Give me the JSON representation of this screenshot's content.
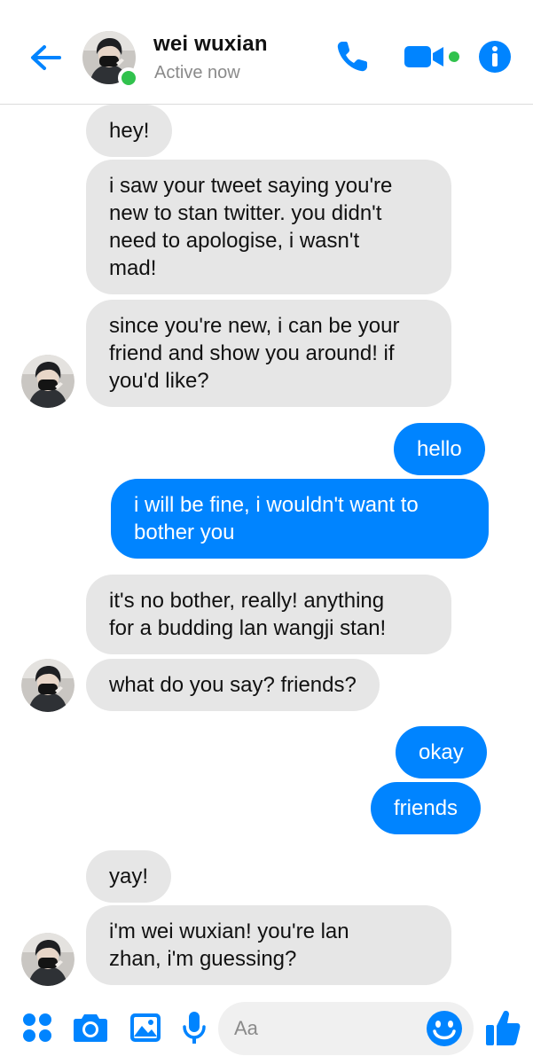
{
  "header": {
    "contact_name": "wei wuxian",
    "status": "Active now"
  },
  "messages": [
    {
      "sender": "contact",
      "text": "hey!"
    },
    {
      "sender": "contact",
      "text": "i saw your tweet saying you're\nnew to stan twitter. you didn't\nneed to apologise, i wasn't\nmad!"
    },
    {
      "sender": "contact",
      "text": "since you're new, i can be your\nfriend and show you around! if\nyou'd like?"
    },
    {
      "sender": "me",
      "text": "hello"
    },
    {
      "sender": "me",
      "text": "i will be fine, i wouldn't want to\nbother you"
    },
    {
      "sender": "contact",
      "text": "it's no bother, really! anything\nfor a budding lan wangji stan!"
    },
    {
      "sender": "contact",
      "text": "what do you say? friends?"
    },
    {
      "sender": "me",
      "text": "okay"
    },
    {
      "sender": "me",
      "text": "friends"
    },
    {
      "sender": "contact",
      "text": "yay!"
    },
    {
      "sender": "contact",
      "text": "i'm wei wuxian! you're lan\nzhan, i'm guessing?"
    }
  ],
  "composer": {
    "placeholder": "Aa"
  },
  "icons": {
    "back": "back-arrow-icon",
    "call": "phone-icon",
    "video": "video-camera-icon",
    "info": "info-icon",
    "more": "four-dots-icon",
    "camera": "camera-icon",
    "gallery": "image-icon",
    "mic": "microphone-icon",
    "emoji": "smiley-icon",
    "like": "thumbs-up-icon"
  },
  "colors": {
    "accent": "#0084ff",
    "incoming_bubble": "#e6e6e6",
    "online": "#31c24d"
  }
}
